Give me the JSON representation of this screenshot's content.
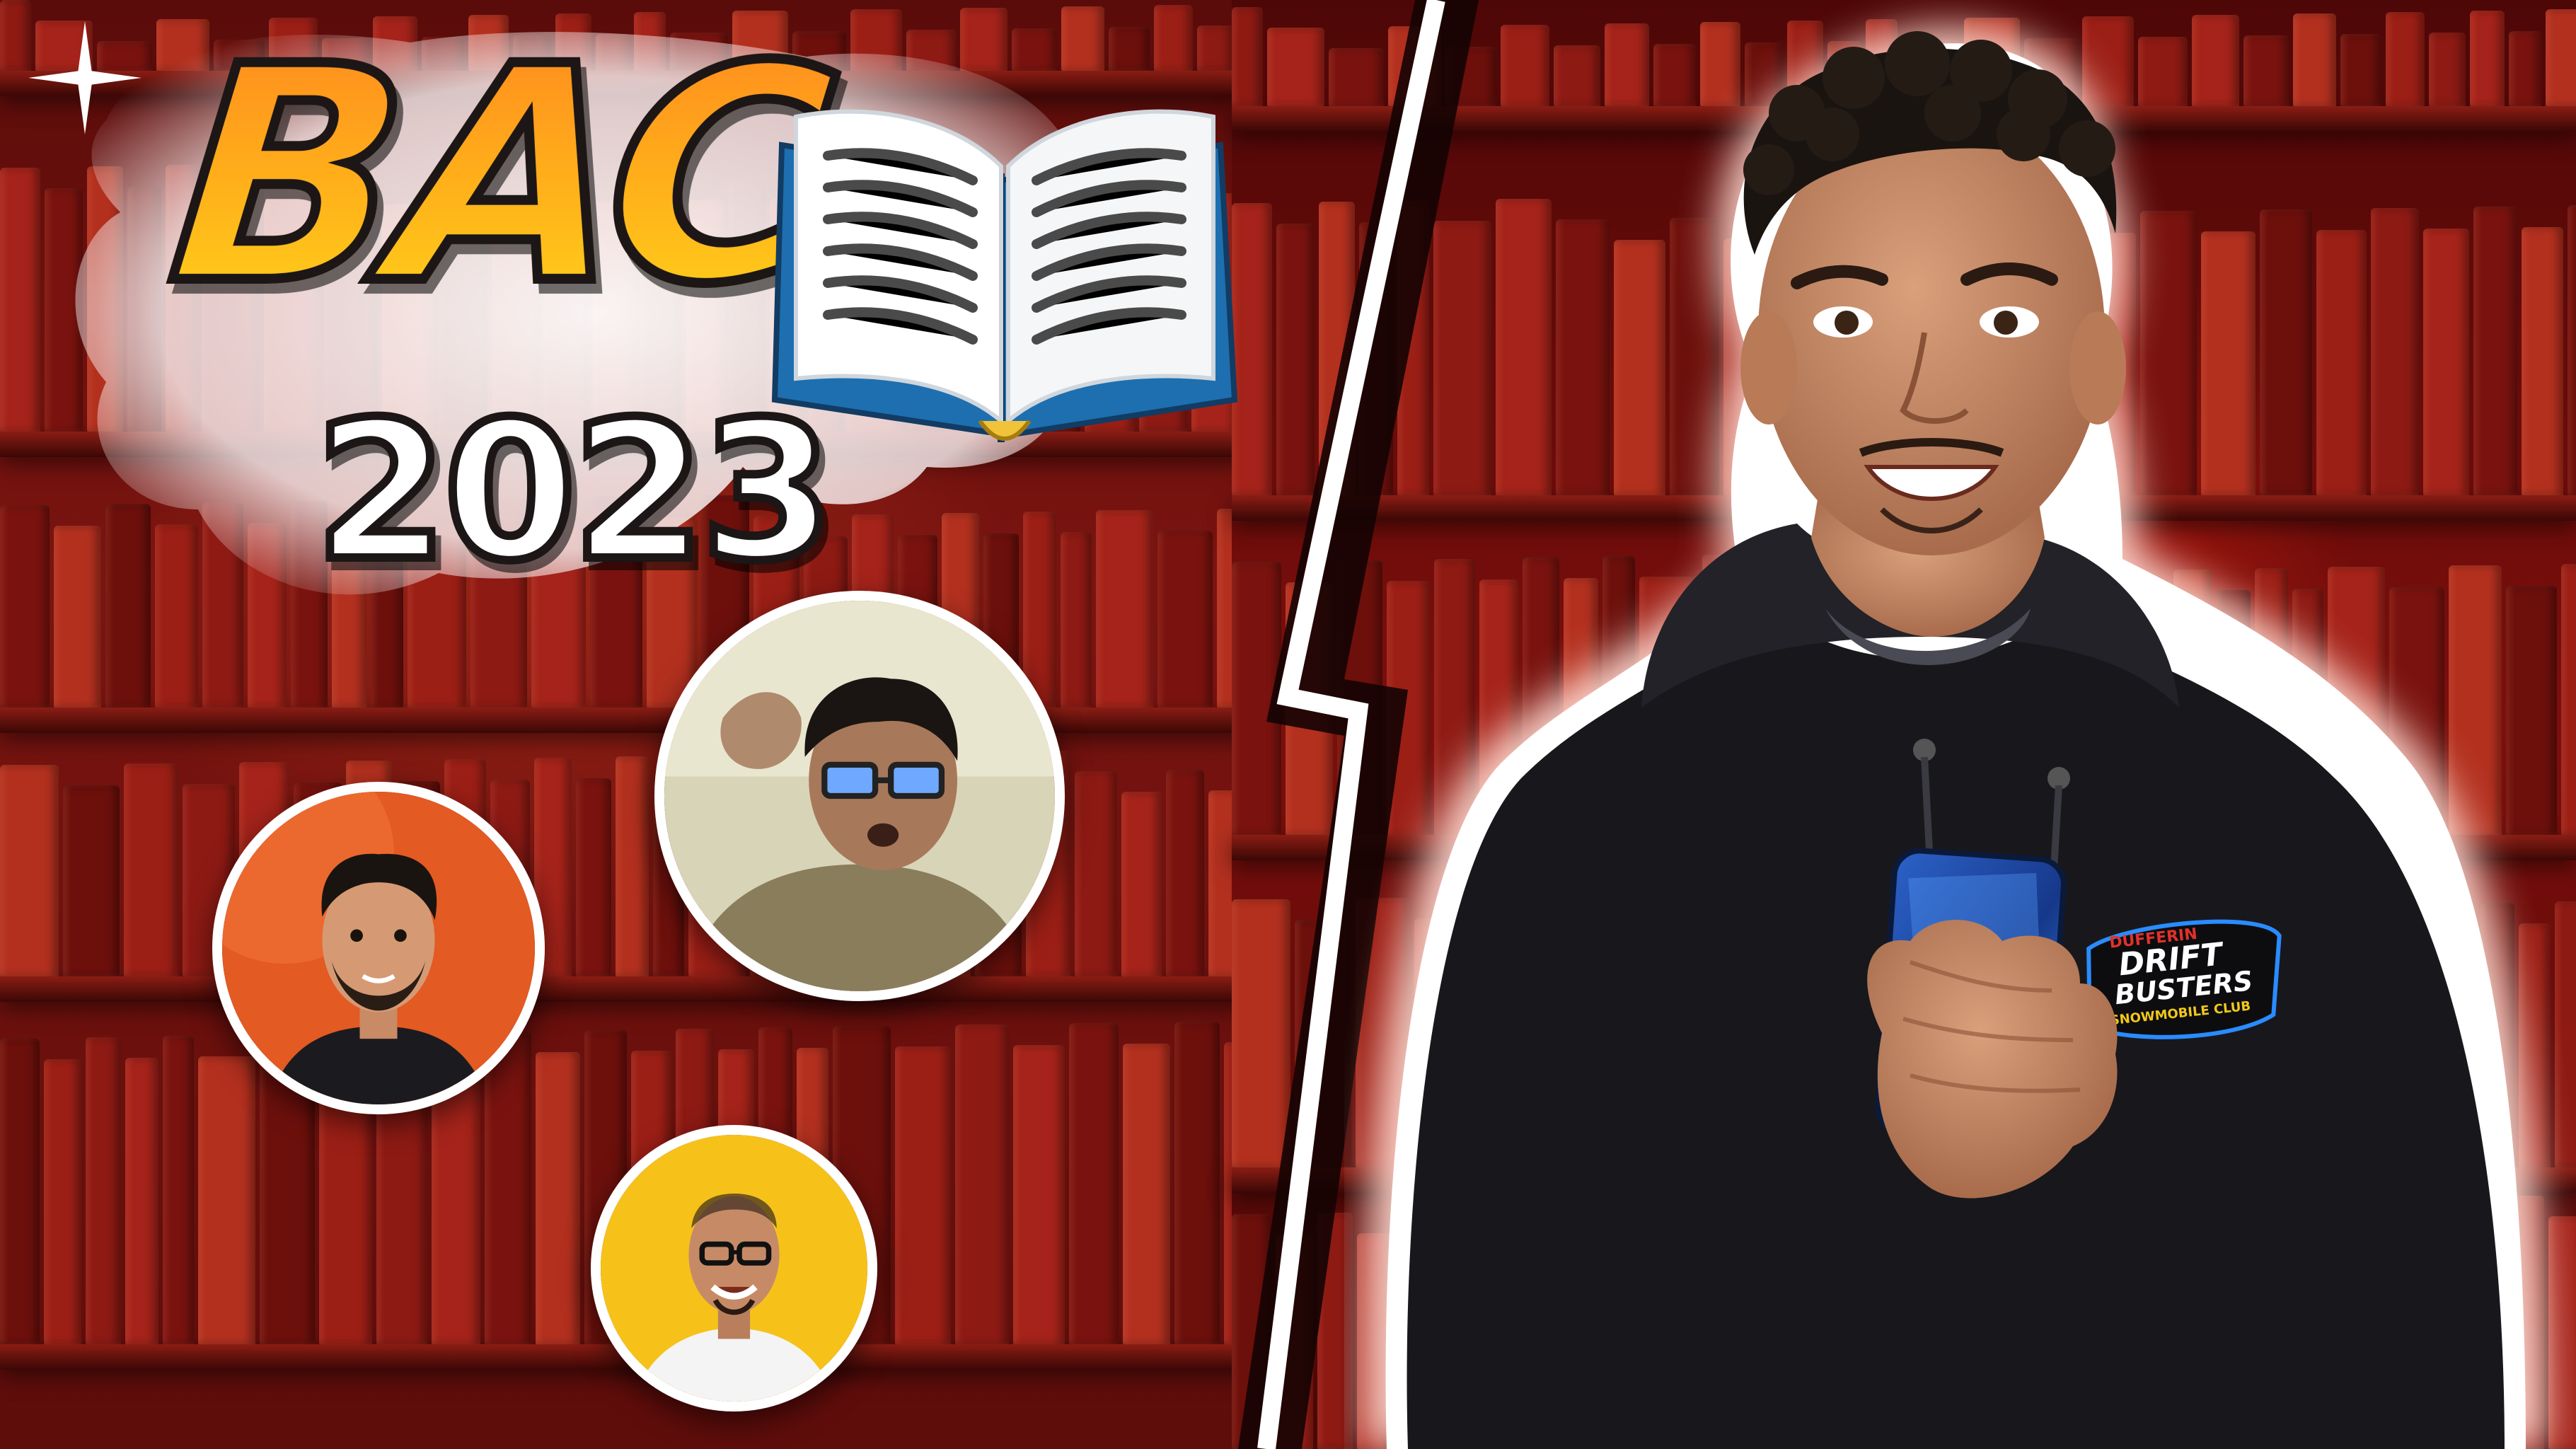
{
  "title": {
    "word": "BAC",
    "year": "2023"
  },
  "icons": {
    "book": "open-book-icon",
    "sparkle": "sparkle-icon",
    "divider": "lightning-divider"
  },
  "hoodie_logo": {
    "line1": "DUFFERIN",
    "line2": "DRIFT",
    "line3": "BUSTERS",
    "line4": "SNOWMOBILE CLUB"
  },
  "colors": {
    "background_red": "#7a1410",
    "title_orange": "#ff8a1e",
    "title_yellow": "#ffd21a",
    "avatar1_bg": "#e35a22",
    "avatar2_bg": "#d8d4b8",
    "avatar3_bg": "#f6c21a",
    "hoodie": "#18181c",
    "phone": "#1e4fa0"
  }
}
